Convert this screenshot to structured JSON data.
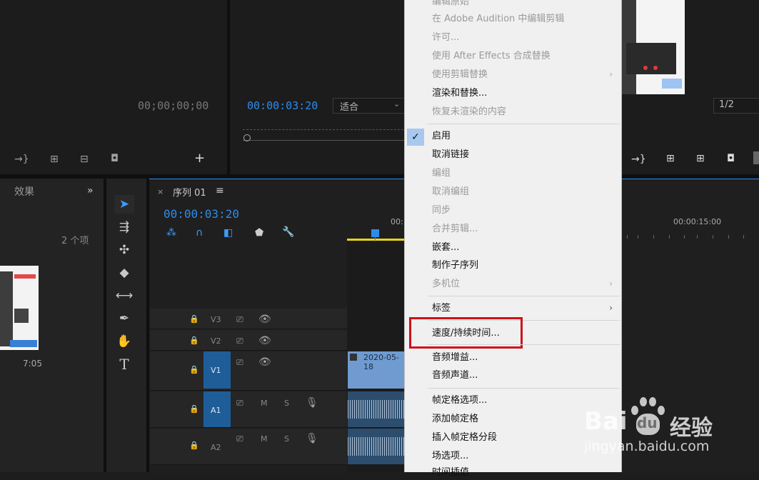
{
  "source_monitor": {
    "timecode": "00;00;00;00"
  },
  "program_monitor": {
    "timecode": "00:00:03:20",
    "fit_label": "适合",
    "quality_label": "1/2"
  },
  "project_panel": {
    "tab_label": "效果",
    "item_count": "2 个项",
    "thumb_duration": "7:05"
  },
  "sequence": {
    "tab_label": "序列 01",
    "timecode": "00:00:03:20",
    "ruler_labels": [
      "00:",
      "00:00:15:00"
    ],
    "tracks": {
      "v3": "V3",
      "v2": "V2",
      "v1": "V1",
      "a1": "A1",
      "a2": "A2",
      "m": "M",
      "s": "S"
    },
    "clip_name": "2020-05-18"
  },
  "context_menu": {
    "items": [
      {
        "label": "编辑原始",
        "enabled": false
      },
      {
        "label": "在 Adobe Audition 中编辑剪辑",
        "enabled": false
      },
      {
        "label": "许可...",
        "enabled": false
      },
      {
        "label": "使用 After Effects 合成替换",
        "enabled": false
      },
      {
        "label": "使用剪辑替换",
        "enabled": false,
        "submenu": true
      },
      {
        "label": "渲染和替换...",
        "enabled": true
      },
      {
        "label": "恢复未渲染的内容",
        "enabled": false
      },
      {
        "label": "启用",
        "enabled": true,
        "checked": true
      },
      {
        "label": "取消链接",
        "enabled": true
      },
      {
        "label": "编组",
        "enabled": false
      },
      {
        "label": "取消编组",
        "enabled": false
      },
      {
        "label": "同步",
        "enabled": false
      },
      {
        "label": "合并剪辑...",
        "enabled": false
      },
      {
        "label": "嵌套...",
        "enabled": true
      },
      {
        "label": "制作子序列",
        "enabled": true
      },
      {
        "label": "多机位",
        "enabled": false,
        "submenu": true
      },
      {
        "label": "标签",
        "enabled": true,
        "submenu": true
      },
      {
        "label": "速度/持续时间...",
        "enabled": true,
        "highlighted": true
      },
      {
        "label": "音频增益...",
        "enabled": true
      },
      {
        "label": "音频声道...",
        "enabled": true
      },
      {
        "label": "帧定格选项...",
        "enabled": true
      },
      {
        "label": "添加帧定格",
        "enabled": true
      },
      {
        "label": "插入帧定格分段",
        "enabled": true
      },
      {
        "label": "场选项...",
        "enabled": true
      },
      {
        "label": "时间插值",
        "enabled": true
      }
    ]
  },
  "watermark": {
    "brand_a": "Bai",
    "brand_b": "du",
    "brand_c": "经验",
    "url": "jingyan.baidu.com"
  },
  "colors": {
    "accent_blue": "#2d8ceb",
    "highlight_red": "#d0101a",
    "track_blue": "#1f5d99",
    "playhead_yellow": "#e6d21f"
  }
}
